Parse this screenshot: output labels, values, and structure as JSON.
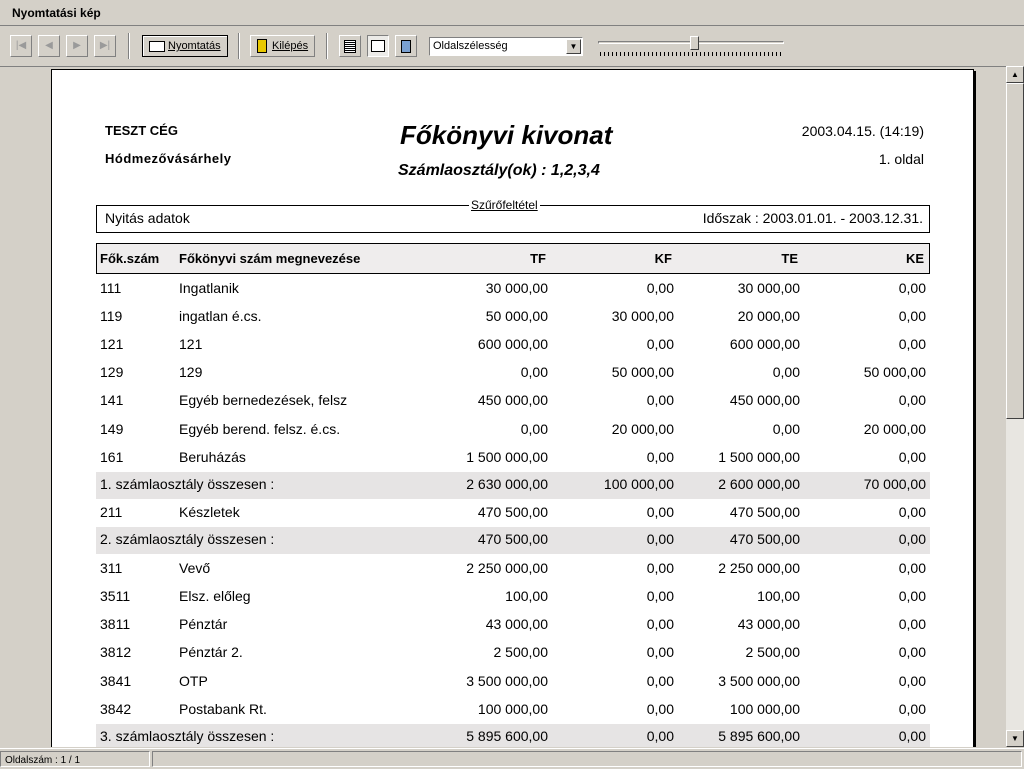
{
  "window": {
    "title": "Nyomtatási kép"
  },
  "toolbar": {
    "nav": [
      "|◀",
      "◀",
      "▶",
      "▶|"
    ],
    "print_label": "Nyomtatás",
    "exit_label": "Kilépés",
    "zoom_select": "Oldalszélesség",
    "zoom_level": 0.52,
    "view_icons": [
      "single-page-icon",
      "page-width-icon",
      "whole-page-icon"
    ]
  },
  "report": {
    "company": "TESZT CÉG",
    "city": "Hódmezővásárhely",
    "title": "Főkönyvi kivonat",
    "subtitle": "Számlaosztály(ok) : 1,2,3,4",
    "datetime": "2003.04.15. (14:19)",
    "page": "1. oldal",
    "filter_label": "Szűrőfeltétel",
    "filter_left": "Nyitás adatok",
    "filter_right": "Időszak : 2003.01.01. - 2003.12.31.",
    "columns": [
      "Fők.szám",
      "Főkönyvi szám megnevezése",
      "TF",
      "KF",
      "TE",
      "KE"
    ],
    "rows": [
      {
        "num": "111",
        "name": "Ingatlanik",
        "tf": "30 000,00",
        "kf": "0,00",
        "te": "30 000,00",
        "ke": "0,00",
        "sub": false
      },
      {
        "num": "119",
        "name": "ingatlan é.cs.",
        "tf": "50 000,00",
        "kf": "30 000,00",
        "te": "20 000,00",
        "ke": "0,00",
        "sub": false
      },
      {
        "num": "121",
        "name": "121",
        "tf": "600 000,00",
        "kf": "0,00",
        "te": "600 000,00",
        "ke": "0,00",
        "sub": false
      },
      {
        "num": "129",
        "name": "129",
        "tf": "0,00",
        "kf": "50 000,00",
        "te": "0,00",
        "ke": "50 000,00",
        "sub": false
      },
      {
        "num": "141",
        "name": "Egyéb bernedezések, felsz",
        "tf": "450 000,00",
        "kf": "0,00",
        "te": "450 000,00",
        "ke": "0,00",
        "sub": false
      },
      {
        "num": "149",
        "name": "Egyéb berend. felsz. é.cs.",
        "tf": "0,00",
        "kf": "20 000,00",
        "te": "0,00",
        "ke": "20 000,00",
        "sub": false
      },
      {
        "num": "161",
        "name": "Beruházás",
        "tf": "1 500 000,00",
        "kf": "0,00",
        "te": "1 500 000,00",
        "ke": "0,00",
        "sub": false
      },
      {
        "num": "1. számlaosztály összesen :",
        "name": "",
        "tf": "2 630 000,00",
        "kf": "100 000,00",
        "te": "2 600 000,00",
        "ke": "70 000,00",
        "sub": true
      },
      {
        "num": "211",
        "name": "Készletek",
        "tf": "470 500,00",
        "kf": "0,00",
        "te": "470 500,00",
        "ke": "0,00",
        "sub": false
      },
      {
        "num": "2. számlaosztály összesen :",
        "name": "",
        "tf": "470 500,00",
        "kf": "0,00",
        "te": "470 500,00",
        "ke": "0,00",
        "sub": true
      },
      {
        "num": "311",
        "name": "Vevő",
        "tf": "2 250 000,00",
        "kf": "0,00",
        "te": "2 250 000,00",
        "ke": "0,00",
        "sub": false
      },
      {
        "num": "3511",
        "name": "Elsz. előleg",
        "tf": "100,00",
        "kf": "0,00",
        "te": "100,00",
        "ke": "0,00",
        "sub": false
      },
      {
        "num": "3811",
        "name": "Pénztár",
        "tf": "43 000,00",
        "kf": "0,00",
        "te": "43 000,00",
        "ke": "0,00",
        "sub": false
      },
      {
        "num": "3812",
        "name": "Pénztár 2.",
        "tf": "2 500,00",
        "kf": "0,00",
        "te": "2 500,00",
        "ke": "0,00",
        "sub": false
      },
      {
        "num": "3841",
        "name": "OTP",
        "tf": "3 500 000,00",
        "kf": "0,00",
        "te": "3 500 000,00",
        "ke": "0,00",
        "sub": false
      },
      {
        "num": "3842",
        "name": "Postabank Rt.",
        "tf": "100 000,00",
        "kf": "0,00",
        "te": "100 000,00",
        "ke": "0,00",
        "sub": false
      },
      {
        "num": "3. számlaosztály összesen :",
        "name": "",
        "tf": "5 895 600,00",
        "kf": "0,00",
        "te": "5 895 600,00",
        "ke": "0,00",
        "sub": true
      }
    ]
  },
  "status": {
    "page_counter": "Oldalszám : 1 / 1"
  }
}
